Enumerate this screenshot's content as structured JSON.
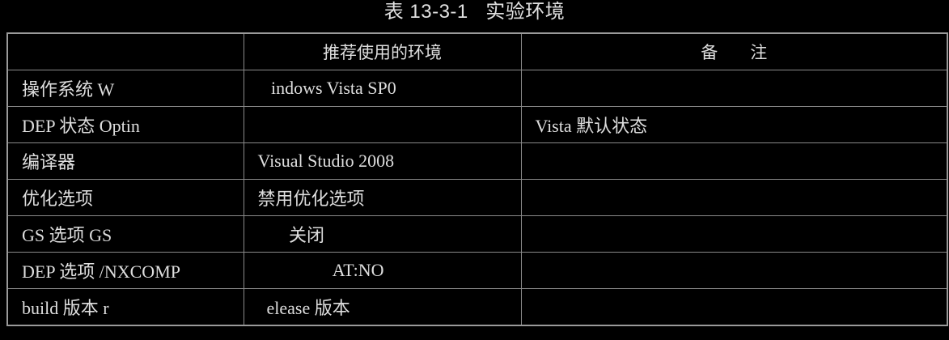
{
  "caption": "表 13-3-1   实验环境",
  "table": {
    "headers": [
      "",
      "推荐使用的环境",
      "备      注"
    ],
    "rows": [
      [
        "操作系统 W",
        "   indows Vista SP0",
        ""
      ],
      [
        "DEP 状态 Optin",
        "",
        "Vista 默认状态"
      ],
      [
        "编译器",
        "Visual Studio 2008",
        ""
      ],
      [
        "优化选项",
        "禁用优化选项",
        ""
      ],
      [
        "GS 选项 GS",
        "       关闭",
        ""
      ],
      [
        "DEP 选项 /NXCOMP",
        "                 AT:NO",
        ""
      ],
      [
        "build 版本 r",
        "  elease 版本",
        ""
      ]
    ]
  }
}
